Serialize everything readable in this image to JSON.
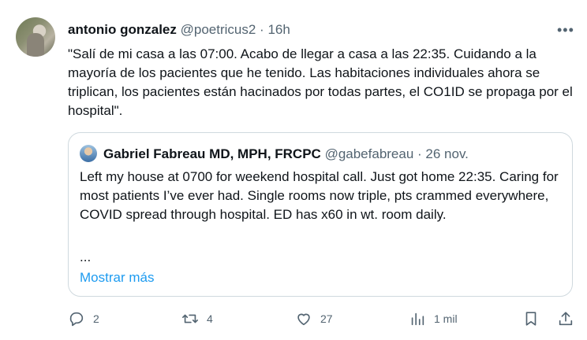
{
  "tweet": {
    "author_name": "antonio gonzalez",
    "author_handle": "@poetricus2",
    "separator": " · ",
    "time": "16h",
    "more_label": "•••",
    "text": "\"Salí de mi casa a las 07:00. Acabo de llegar a casa a las 22:35. Cuidando a la mayoría de los pacientes que he tenido. Las habitaciones individuales ahora se triplican, los pacientes están hacinados por todas partes, el CO1ID se propaga por el hospital\"."
  },
  "quote": {
    "author_name": "Gabriel Fabreau MD, MPH, FRCPC",
    "author_handle": "@gabefabreau",
    "separator": " · ",
    "date": "26 nov.",
    "text": "Left my house at 0700 for weekend hospital call. Just got home 22:35. Caring for most patients I’ve ever had. Single rooms now triple, pts crammed everywhere, COVID spread through hospital. ED has x60 in wt. room daily.",
    "ellipsis": "...",
    "show_more": "Mostrar más"
  },
  "actions": {
    "replies": "2",
    "retweets": "4",
    "likes": "27",
    "views": "1 mil"
  },
  "icons": [
    "reply-icon",
    "retweet-icon",
    "like-icon",
    "views-icon",
    "bookmark-icon",
    "share-icon",
    "more-icon"
  ],
  "colors": {
    "link": "#1d9bf0",
    "muted": "#536471",
    "text": "#0f1419",
    "border": "#cfd9de"
  }
}
